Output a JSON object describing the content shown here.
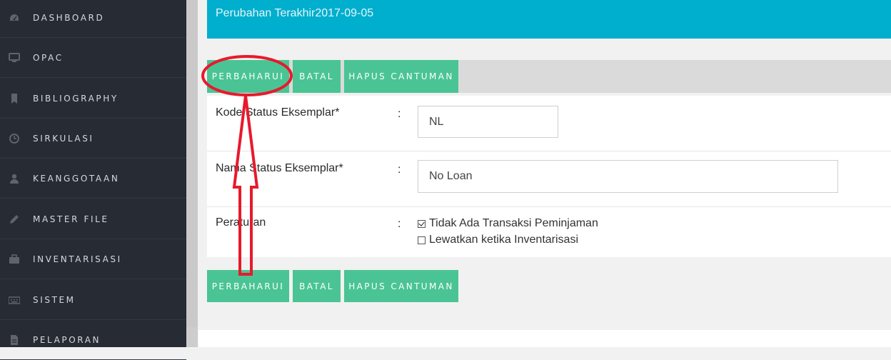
{
  "sidebar": {
    "items": [
      {
        "label": "DASHBOARD",
        "icon": "dashboard-icon"
      },
      {
        "label": "OPAC",
        "icon": "monitor-icon"
      },
      {
        "label": "BIBLIOGRAPHY",
        "icon": "bookmark-icon"
      },
      {
        "label": "SIRKULASI",
        "icon": "clock-icon"
      },
      {
        "label": "KEANGGOTAAN",
        "icon": "user-icon"
      },
      {
        "label": "MASTER FILE",
        "icon": "pencil-icon"
      },
      {
        "label": "INVENTARISASI",
        "icon": "briefcase-icon"
      },
      {
        "label": "SISTEM",
        "icon": "keyboard-icon"
      },
      {
        "label": "PELAPORAN",
        "icon": "file-icon"
      }
    ]
  },
  "banner": {
    "last_changed": "Perubahan Terakhir2017-09-05"
  },
  "toolbar": {
    "update_label": "PERBAHARUI",
    "cancel_label": "BATAL",
    "delete_label": "HAPUS CANTUMAN"
  },
  "form": {
    "code": {
      "label": "Kode Status Eksemplar*",
      "colon": ":",
      "value": "NL"
    },
    "name": {
      "label": "Nama Status Eksemplar*",
      "colon": ":",
      "value": "No Loan"
    },
    "rules": {
      "label": "Peraturan",
      "colon": ":",
      "options": [
        {
          "label": "Tidak Ada Transaksi Peminjaman",
          "checked": true
        },
        {
          "label": "Lewatkan ketika Inventarisasi",
          "checked": false
        }
      ]
    }
  },
  "colors": {
    "sidebar_bg": "#272b33",
    "banner_bg": "#00aecd",
    "button_bg": "#4ac494",
    "annotation": "#e8192c"
  }
}
